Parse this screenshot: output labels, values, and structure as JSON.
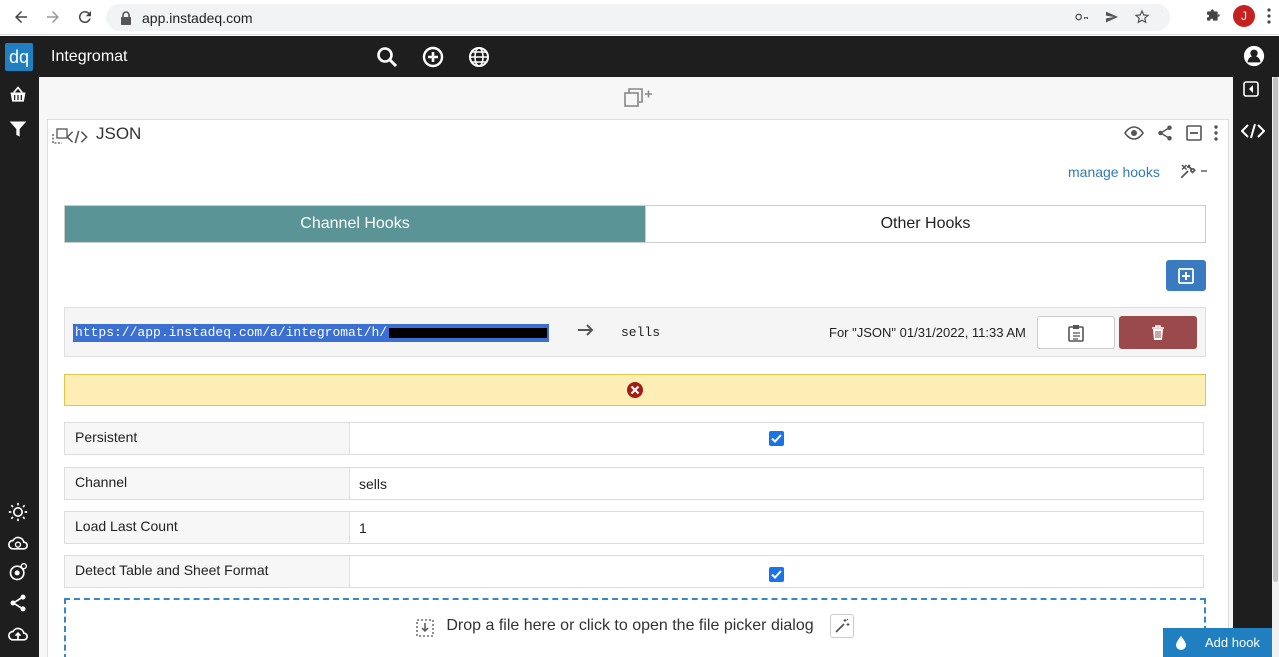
{
  "browser": {
    "url": "app.instadeq.com",
    "profile_initial": "J"
  },
  "app": {
    "logo_text": "dq",
    "title": "Integromat"
  },
  "panel": {
    "title": "JSON",
    "manage_hooks_label": "manage hooks"
  },
  "tabs": [
    {
      "label": "Channel Hooks",
      "active": true
    },
    {
      "label": "Other Hooks",
      "active": false
    }
  ],
  "hook": {
    "url": "https://app.instadeq.com/a/integromat/h/",
    "channel": "sells",
    "meta": "For \"JSON\" 01/31/2022, 11:33 AM"
  },
  "properties": [
    {
      "label": "Persistent",
      "type": "checkbox",
      "checked": true
    },
    {
      "label": "Channel",
      "type": "text",
      "value": "sells"
    },
    {
      "label": "Load Last Count",
      "type": "text",
      "value": "1"
    },
    {
      "label": "Detect Table and Sheet Format",
      "type": "checkbox",
      "checked": true
    }
  ],
  "dropzone": {
    "text": "Drop a file here or click to open the file picker dialog"
  },
  "add_hook_label": "Add hook",
  "colors": {
    "active_tab": "#5a9497",
    "primary_button": "#3a7abf",
    "delete_button": "#9a4a4a",
    "warning_bg": "#fdeeb5"
  }
}
